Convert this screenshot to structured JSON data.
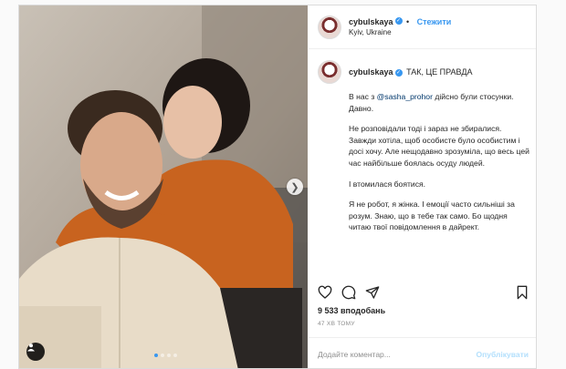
{
  "post": {
    "username": "cybulskaya",
    "follow_label": "Стежити",
    "location": "Kyiv, Ukraine",
    "caption_title": "ТАК, ЦЕ ПРАВДА",
    "caption": {
      "p1_before": "В нас з ",
      "p1_mention": "@sasha_prohor",
      "p1_after": " дійсно були стосунки.",
      "p1_line2": "Давно.",
      "p2": "Не розповідали тоді і зараз не збиралися. Завжди хотіла, щоб особисте було особистим і досі хочу. Але нещодавно зрозуміла, що весь цей час найбільше боялась осуду людей.",
      "p3": "І втомилася боятися.",
      "p4": "Я не робот, я жінка. І емоції часто сильніші за розум. Знаю, що в тебе так само. Бо щодня читаю твої повідомлення в дайрект."
    },
    "likes": "9 533 вподобань",
    "time": "47 ХВ ТОМУ",
    "comment_placeholder": "Додайте коментар...",
    "publish_label": "Опублікувати",
    "carousel": {
      "slides": 4,
      "active": 1
    }
  },
  "icons": {
    "verified": "verified-badge-icon",
    "like": "heart-icon",
    "comment": "comment-icon",
    "share": "share-icon",
    "save": "bookmark-icon",
    "next": "chevron-right-icon",
    "tag": "user-tag-icon"
  },
  "colors": {
    "accent": "#3897f0",
    "publish_disabled": "#b2dffc"
  }
}
